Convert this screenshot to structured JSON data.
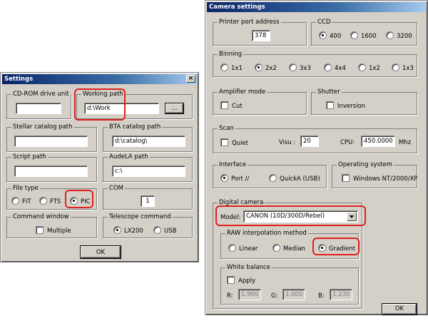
{
  "settings": {
    "title": "Settings",
    "cdrom": {
      "label": "CD-ROM drive unit",
      "value": ""
    },
    "working_path": {
      "label": "Working path",
      "value": "d:\\Work",
      "browse": "..."
    },
    "stellar": {
      "label": "Stellar catalog path",
      "value": ""
    },
    "bta": {
      "label": "BTA catalog path",
      "value": "d:\\catalog\\"
    },
    "script": {
      "label": "Script path",
      "value": ""
    },
    "audela": {
      "label": "AudeLA path",
      "value": "c:\\"
    },
    "file_type": {
      "label": "File type",
      "options": [
        "FIT",
        "FTS",
        "PIC"
      ],
      "selected": "PIC"
    },
    "com": {
      "label": "COM",
      "value": "1"
    },
    "command_window": {
      "label": "Command window",
      "multiple": "Multiple"
    },
    "telescope": {
      "label": "Telescope command",
      "options": [
        "LX200",
        "USB"
      ],
      "selected": "LX200"
    },
    "ok": "OK"
  },
  "camera": {
    "title": "Camera settings",
    "printer_port": {
      "label": "Printer port address",
      "value": "378"
    },
    "ccd": {
      "label": "CCD",
      "options": [
        "400",
        "1600",
        "3200"
      ],
      "selected": "400"
    },
    "binning": {
      "label": "Binning",
      "options": [
        "1x1",
        "2x2",
        "3x3",
        "4x4",
        "1x2",
        "1x3"
      ],
      "selected": "2x2"
    },
    "amplifier": {
      "label": "Amplifier mode",
      "cut": "Cut"
    },
    "shutter": {
      "label": "Shutter",
      "inversion": "Inversion"
    },
    "scan": {
      "label": "Scan",
      "quiet": "Quiet",
      "visu_label": "Visu :",
      "visu_value": "20",
      "cpu_label": "CPU:",
      "cpu_value": "450.0000",
      "cpu_unit": "Mhz"
    },
    "interface": {
      "label": "Interface",
      "options": [
        "Port //",
        "QuickA (USB)"
      ],
      "selected": "Port //"
    },
    "os": {
      "label": "Operating system",
      "windows": "Windows NT/2000/XP"
    },
    "digital_camera": {
      "label": "Digital camera",
      "model_label": "Model:",
      "model_value": "CANON (10D/300D/Rebel)"
    },
    "raw": {
      "label": "RAW interpolation method",
      "options": [
        "Linear",
        "Median",
        "Gradient"
      ],
      "selected": "Gradient"
    },
    "white_balance": {
      "label": "White balance",
      "apply": "Apply",
      "r_label": "R:",
      "r_value": "1.960",
      "g_label": "G:",
      "g_value": "1.000",
      "b_label": "B:",
      "b_value": "1.230"
    },
    "ok": "OK"
  },
  "colors": {
    "highlight": "#e0201a",
    "title_start": "#0a246a",
    "title_end": "#a6caf0",
    "face": "#d4d0c8"
  }
}
